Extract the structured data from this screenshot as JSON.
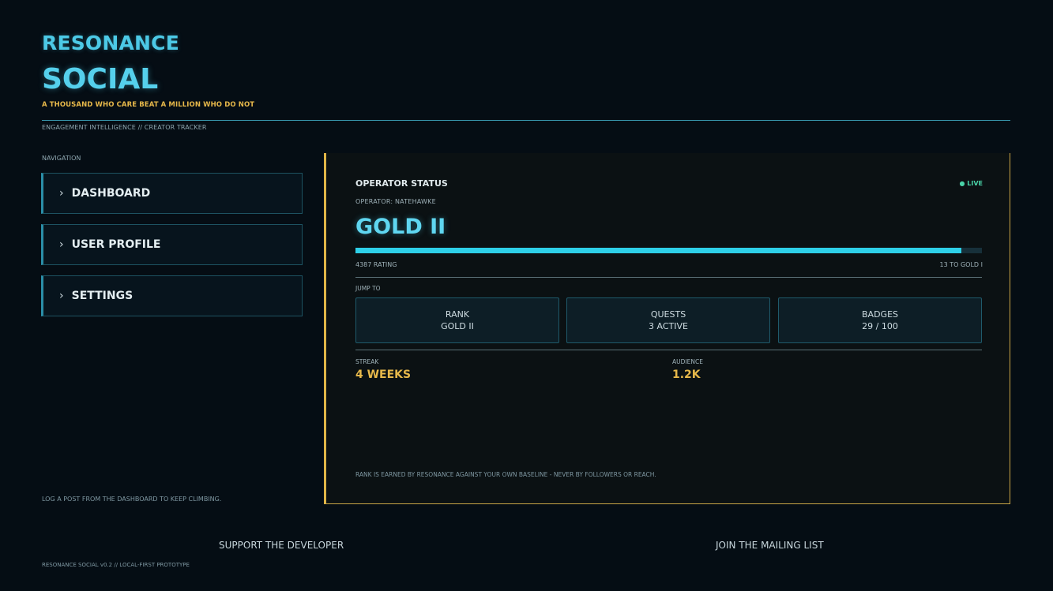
{
  "brand": {
    "line1": "RESONANCE",
    "line2": "SOCIAL",
    "tagline": "A THOUSAND WHO CARE BEAT A MILLION WHO DO NOT",
    "subtitle": "ENGAGEMENT INTELLIGENCE // CREATOR TRACKER"
  },
  "nav": {
    "label": "NAVIGATION",
    "chevron": "›",
    "items": [
      {
        "label": "DASHBOARD"
      },
      {
        "label": "USER PROFILE"
      },
      {
        "label": "SETTINGS"
      }
    ],
    "hint": "LOG A POST FROM THE DASHBOARD TO KEEP CLIMBING."
  },
  "status": {
    "title": "OPERATOR STATUS",
    "live": "● LIVE",
    "operator": "OPERATOR: NATEHAWKE",
    "rank": "GOLD II",
    "progress": 0.967,
    "rating": "4387 RATING",
    "to_next": "13 TO GOLD I",
    "jump_label": "JUMP TO",
    "tiles": [
      {
        "title": "RANK",
        "value": "GOLD II"
      },
      {
        "title": "QUESTS",
        "value": "3 ACTIVE"
      },
      {
        "title": "BADGES",
        "value": "29 / 100"
      }
    ],
    "streak_label": "STREAK",
    "streak_value": "4 WEEKS",
    "audience_label": "AUDIENCE",
    "audience_value": "1.2K",
    "note": "RANK IS EARNED BY RESONANCE AGAINST YOUR OWN BASELINE - NEVER BY FOLLOWERS OR REACH."
  },
  "footer": {
    "support": "SUPPORT THE DEVELOPER",
    "mailing": "JOIN THE MAILING LIST",
    "version": "RESONANCE SOCIAL v0.2  //  LOCAL-FIRST PROTOTYPE"
  },
  "colors": {
    "accent": "#4cc9e6",
    "gold": "#e6b84a",
    "live": "#49d3a8",
    "background": "#050d14"
  }
}
